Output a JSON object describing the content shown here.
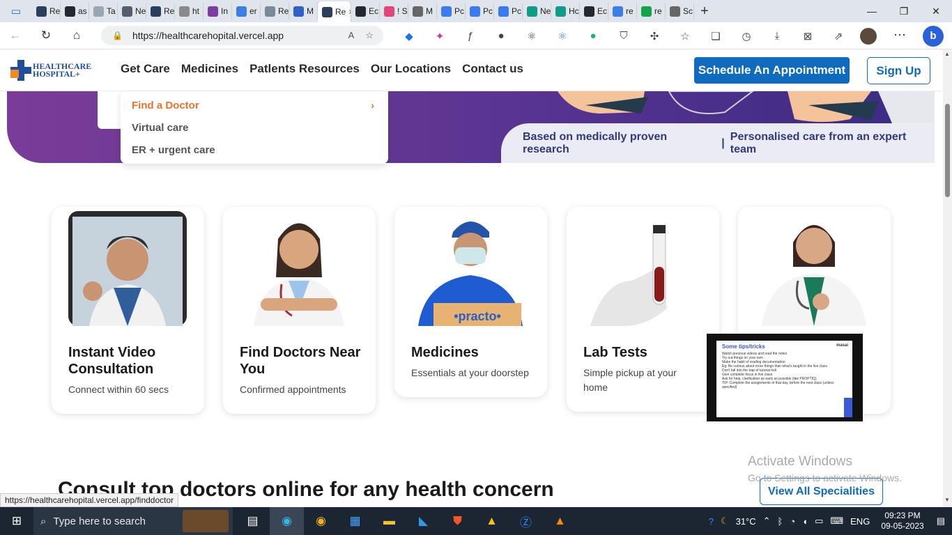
{
  "browser": {
    "tabs": [
      {
        "label": "Re",
        "color": "#2b3e5b",
        "active": false
      },
      {
        "label": "as",
        "color": "#24292f",
        "active": false
      },
      {
        "label": "Ta",
        "color": "#9aa7b3",
        "active": false
      },
      {
        "label": "Ne",
        "color": "#555f6b",
        "active": false
      },
      {
        "label": "Re",
        "color": "#2b3e5b",
        "active": false
      },
      {
        "label": "ht",
        "color": "#8a8a8a",
        "active": false
      },
      {
        "label": "In",
        "color": "#7b3fa0",
        "active": false
      },
      {
        "label": "er",
        "color": "#3d7ee6",
        "active": false
      },
      {
        "label": "Re",
        "color": "#7a8a98",
        "active": false
      },
      {
        "label": "M",
        "color": "#2f61c9",
        "active": false
      },
      {
        "label": "Re",
        "color": "#2b3e5b",
        "active": true
      },
      {
        "label": "Ec",
        "color": "#24292f",
        "active": false
      },
      {
        "label": "! S",
        "color": "#e0457b",
        "active": false
      },
      {
        "label": "M",
        "color": "#666666",
        "active": false
      },
      {
        "label": "Pc",
        "color": "#3a7bf0",
        "active": false
      },
      {
        "label": "Pc",
        "color": "#3a7bf0",
        "active": false
      },
      {
        "label": "Pc",
        "color": "#3a7bf0",
        "active": false
      },
      {
        "label": "Ne",
        "color": "#0f9d8a",
        "active": false
      },
      {
        "label": "Hc",
        "color": "#0f9d8a",
        "active": false
      },
      {
        "label": "Ec",
        "color": "#24292f",
        "active": false
      },
      {
        "label": "re",
        "color": "#3d7ee6",
        "active": false
      },
      {
        "label": "re",
        "color": "#16a34a",
        "active": false
      },
      {
        "label": "Sc",
        "color": "#666666",
        "active": false
      }
    ],
    "close_tab": "×",
    "new_tab": "+",
    "url": "https://healthcarehopital.vercel.app",
    "status_url": "https://healthcarehopital.vercel.app/finddoctor"
  },
  "site": {
    "logo_line1": "HEALTHCARE",
    "logo_line2": "HOSPITAL+",
    "nav": [
      "Get Care",
      "Medicines",
      "Patlents Resources",
      "Our Locations",
      "Contact us"
    ],
    "appointment_button": "Schedule An Appointment",
    "signup_button": "Sign Up",
    "hero_strip": {
      "left": "Based on medically proven research",
      "separator": "|",
      "right": "Personalised care from an expert team"
    },
    "dropdown": [
      {
        "label": "Find a Doctor",
        "active": true
      },
      {
        "label": "Virtual care",
        "active": false
      },
      {
        "label": "ER + urgent care",
        "active": false
      }
    ],
    "dropdown_chevron": "›",
    "cards": [
      {
        "title": "Instant Video Consultation",
        "subtitle": "Connect within 60 secs"
      },
      {
        "title": "Find Doctors Near You",
        "subtitle": "Confirmed appointments"
      },
      {
        "title": "Medicines",
        "subtitle": "Essentials at your doorstep",
        "box_text": "•practo•"
      },
      {
        "title": "Lab Tests",
        "subtitle": "Simple pickup at your home"
      },
      {
        "title": "",
        "subtitle": ""
      }
    ],
    "section_title": "Consult top doctors online for any health concern",
    "view_all": "View All Specialities"
  },
  "pip": {
    "title": "Some tips/tricks",
    "brand": "masai",
    "lines": [
      "Watch precious videos and read the notes",
      "Try out things on your own",
      "Make the habit of reading documentation",
      "Eg: Be curious about more things than what's taught in the live class",
      "Don't fall into the trap of tutorial hell",
      "Give complete focus in live class",
      "Ask for help, clarification as early as possible (like PROPTIQ)",
      "TIP: Complete the assignments of that day, before the next class (unless specified)"
    ]
  },
  "windows": {
    "watermark_title": "Activate Windows",
    "watermark_sub": "Go to Settings to activate Windows.",
    "search_placeholder": "Type here to search",
    "temperature": "31°C",
    "language": "ENG",
    "time": "09:23 PM",
    "date": "09-05-2023"
  }
}
